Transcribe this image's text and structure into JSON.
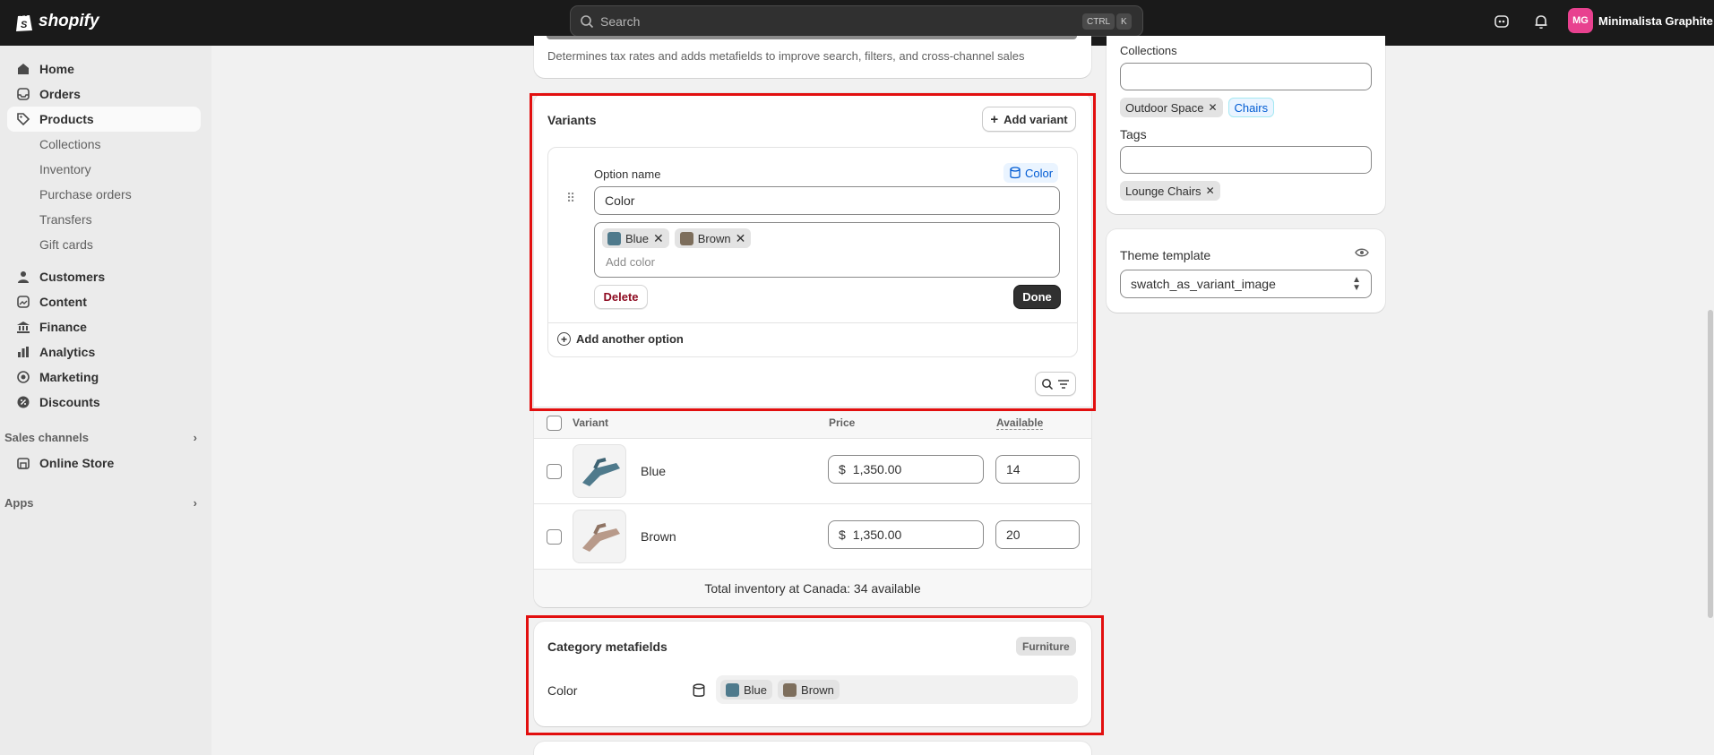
{
  "topbar": {
    "brand": "shopify",
    "search_placeholder": "Search",
    "shortcut_ctrl": "CTRL",
    "shortcut_k": "K",
    "store_initials": "MG",
    "store_name": "Minimalista Graphite"
  },
  "sidebar": {
    "home": "Home",
    "orders": "Orders",
    "products": "Products",
    "products_sub": [
      "Collections",
      "Inventory",
      "Purchase orders",
      "Transfers",
      "Gift cards"
    ],
    "customers": "Customers",
    "content": "Content",
    "finance": "Finance",
    "analytics": "Analytics",
    "marketing": "Marketing",
    "discounts": "Discounts",
    "sales_channels": "Sales channels",
    "online_store": "Online Store",
    "apps": "Apps"
  },
  "category_card": {
    "help_text": "Determines tax rates and adds metafields to improve search, filters, and cross-channel sales"
  },
  "variants": {
    "title": "Variants",
    "add_variant": "Add variant",
    "option_name_label": "Option name",
    "option_badge": "Color",
    "option_name_value": "Color",
    "values": [
      {
        "name": "Blue",
        "color": "#4f7a8c"
      },
      {
        "name": "Brown",
        "color": "#7d6e5c"
      }
    ],
    "add_value_placeholder": "Add color",
    "delete_label": "Delete",
    "done_label": "Done",
    "add_another_option": "Add another option",
    "table_headers": {
      "variant": "Variant",
      "price": "Price",
      "available": "Available"
    },
    "rows": [
      {
        "name": "Blue",
        "currency": "$",
        "price": "1,350.00",
        "available": "14"
      },
      {
        "name": "Brown",
        "currency": "$",
        "price": "1,350.00",
        "available": "20"
      }
    ],
    "total_inventory": "Total inventory at Canada: 34 available"
  },
  "metafields": {
    "title": "Category metafields",
    "badge": "Furniture",
    "color_label": "Color",
    "values": [
      {
        "name": "Blue",
        "color": "#4f7a8c"
      },
      {
        "name": "Brown",
        "color": "#7d6e5c"
      }
    ]
  },
  "organization": {
    "collections_label": "Collections",
    "collections": [
      "Outdoor Space",
      "Chairs"
    ],
    "tags_label": "Tags",
    "tags": [
      "Lounge Chairs"
    ]
  },
  "theme": {
    "label": "Theme template",
    "value": "swatch_as_variant_image"
  }
}
